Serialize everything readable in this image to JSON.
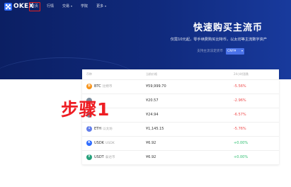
{
  "header": {
    "logo_text": "OKEX",
    "nav": [
      {
        "label": "首页",
        "highlighted": true,
        "has_caret": false
      },
      {
        "label": "行情",
        "highlighted": false,
        "has_caret": false
      },
      {
        "label": "交易",
        "highlighted": false,
        "has_caret": true
      },
      {
        "label": "学院",
        "highlighted": false,
        "has_caret": false
      },
      {
        "label": "更多",
        "highlighted": false,
        "has_caret": true
      }
    ]
  },
  "hero": {
    "title": "快速购买主流币",
    "subtitle": "仅需10元起，零手续费购买比特币，以太坊等主流数字资产",
    "currency_label": "支持主流法定货币",
    "currency_value": "CNY¥"
  },
  "market": {
    "columns": [
      "币种",
      "当前价格",
      "24小时涨跌"
    ],
    "rows": [
      {
        "symbol": "BTC",
        "name": "比特币",
        "price": "¥59,999.70",
        "change": "-5.56%",
        "direction": "down",
        "icon_color": "#f7931a",
        "icon_glyph": "₿",
        "icon_name": "btc-icon"
      },
      {
        "symbol": "",
        "name": "",
        "price": "¥20.57",
        "change": "-2.96%",
        "direction": "down",
        "icon_color": "#7b8b9c",
        "icon_glyph": "",
        "icon_name": "coin-icon"
      },
      {
        "symbol": "",
        "name": "",
        "price": "¥24.94",
        "change": "-6.57%",
        "direction": "down",
        "icon_color": "#7b8b9c",
        "icon_glyph": "",
        "icon_name": "coin-icon"
      },
      {
        "symbol": "ETH",
        "name": "以太坊",
        "price": "¥1,145.15",
        "change": "-5.76%",
        "direction": "down",
        "icon_color": "#627eea",
        "icon_glyph": "Ξ",
        "icon_name": "eth-icon"
      },
      {
        "symbol": "USDK",
        "name": "USDK",
        "price": "¥6.92",
        "change": "+0.00%",
        "direction": "up",
        "icon_color": "#2d6bff",
        "icon_glyph": "K",
        "icon_name": "usdk-icon"
      },
      {
        "symbol": "USDT",
        "name": "泰达币",
        "price": "¥6.92",
        "change": "+0.00%",
        "direction": "up",
        "icon_color": "#26a17b",
        "icon_glyph": "₮",
        "icon_name": "usdt-icon"
      }
    ]
  },
  "annotation": {
    "step_text": "步骤1",
    "color": "#ee1d23"
  }
}
